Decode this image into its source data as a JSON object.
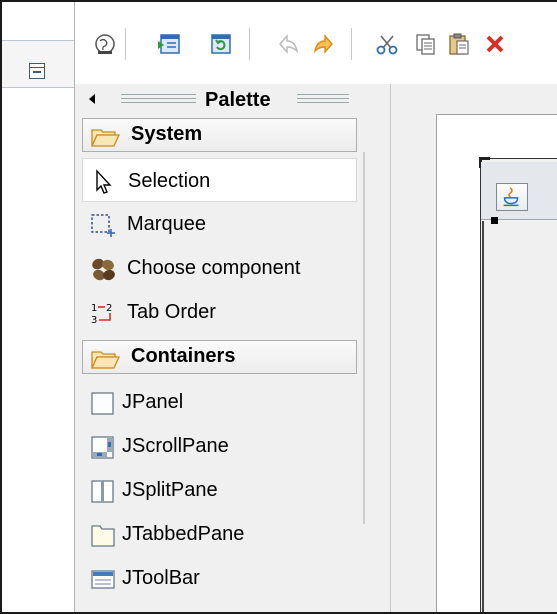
{
  "palette": {
    "title": "Palette",
    "drawers": [
      {
        "label": "System",
        "items": [
          {
            "label": "Selection",
            "icon": "arrow-cursor-icon",
            "selected": true
          },
          {
            "label": "Marquee",
            "icon": "marquee-icon",
            "selected": false
          },
          {
            "label": "Choose component",
            "icon": "beans-icon",
            "selected": false
          },
          {
            "label": "Tab Order",
            "icon": "tab-order-icon",
            "selected": false
          }
        ]
      },
      {
        "label": "Containers",
        "items": [
          {
            "label": "JPanel",
            "icon": "jpanel-icon"
          },
          {
            "label": "JScrollPane",
            "icon": "jscrollpane-icon"
          },
          {
            "label": "JSplitPane",
            "icon": "jsplitpane-icon"
          },
          {
            "label": "JTabbedPane",
            "icon": "jtabbedpane-icon"
          },
          {
            "label": "JToolBar",
            "icon": "jtoolbar-icon"
          }
        ]
      }
    ]
  },
  "toolbar": {
    "buttons": [
      "globe-icon",
      "preview-icon",
      "refresh-icon",
      "undo-icon",
      "redo-icon",
      "cut-icon",
      "copy-icon",
      "paste-icon",
      "delete-icon"
    ]
  },
  "colors": {
    "accent_blue": "#2f6db5",
    "folder_orange": "#e9a030",
    "redo_orange": "#f0a030",
    "delete_red": "#d93025",
    "selection_bg": "#ffffff",
    "panel_bg": "#f0f0f0"
  }
}
